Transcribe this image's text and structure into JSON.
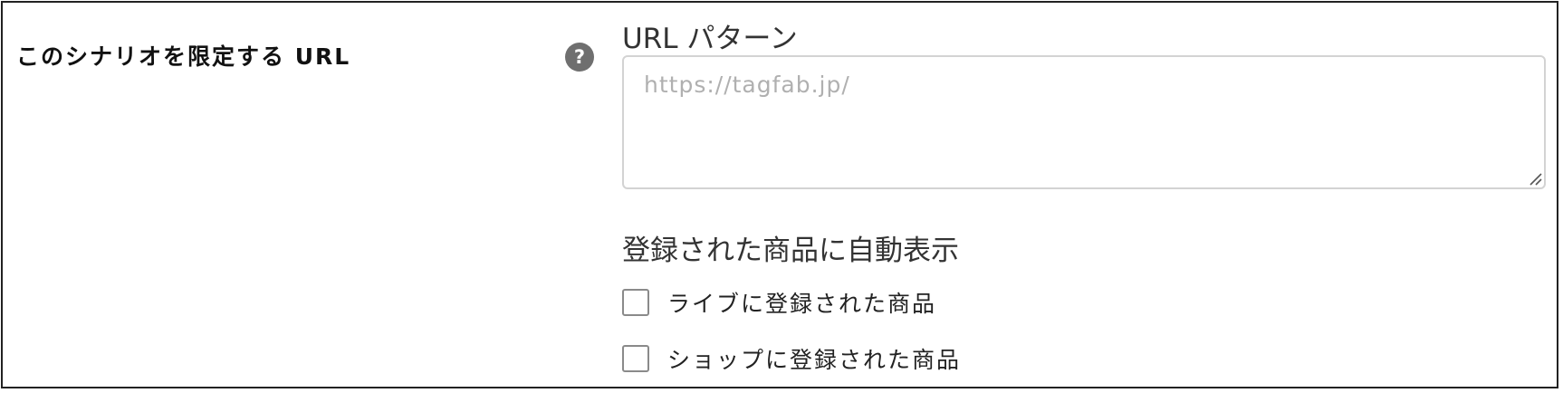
{
  "row": {
    "label": "このシナリオを限定する URL",
    "help_icon": "question-circle-icon",
    "help_glyph": "?"
  },
  "url_pattern": {
    "label": "URL パターン",
    "placeholder": "https://tagfab.jp/",
    "value": ""
  },
  "auto_display": {
    "heading": "登録された商品に自動表示",
    "options": [
      {
        "label": "ライブに登録された商品",
        "checked": false
      },
      {
        "label": "ショップに登録された商品",
        "checked": false
      }
    ]
  },
  "colors": {
    "border": "#222222",
    "help_icon_bg": "#6f6f6f",
    "input_border": "#d3d3d3",
    "placeholder": "#b0b0b0",
    "checkbox_border": "#8a8a8a"
  }
}
